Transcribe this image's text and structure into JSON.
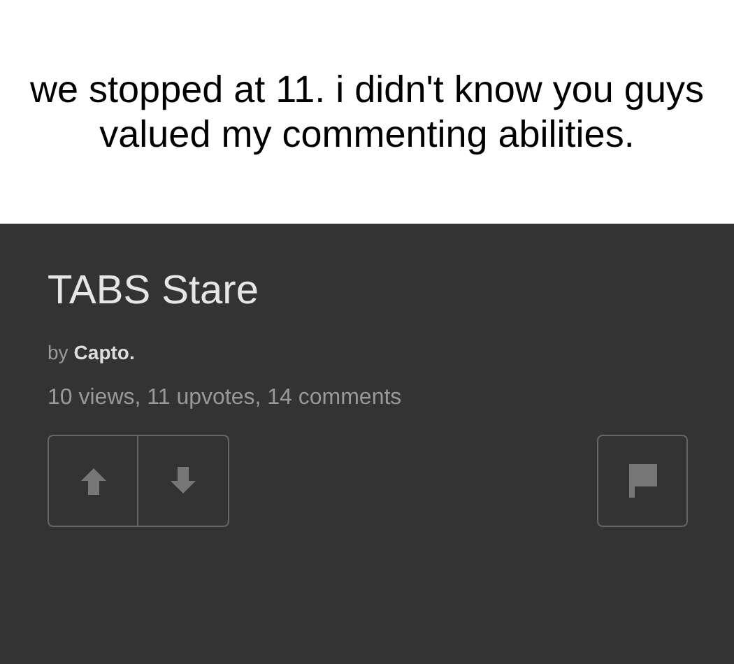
{
  "caption": "we stopped at 11. i didn't know you guys valued my commenting abilities.",
  "post": {
    "title": "TABS Stare",
    "by_label": "by",
    "author": "Capto.",
    "stats": "10 views, 11 upvotes, 14 comments"
  }
}
